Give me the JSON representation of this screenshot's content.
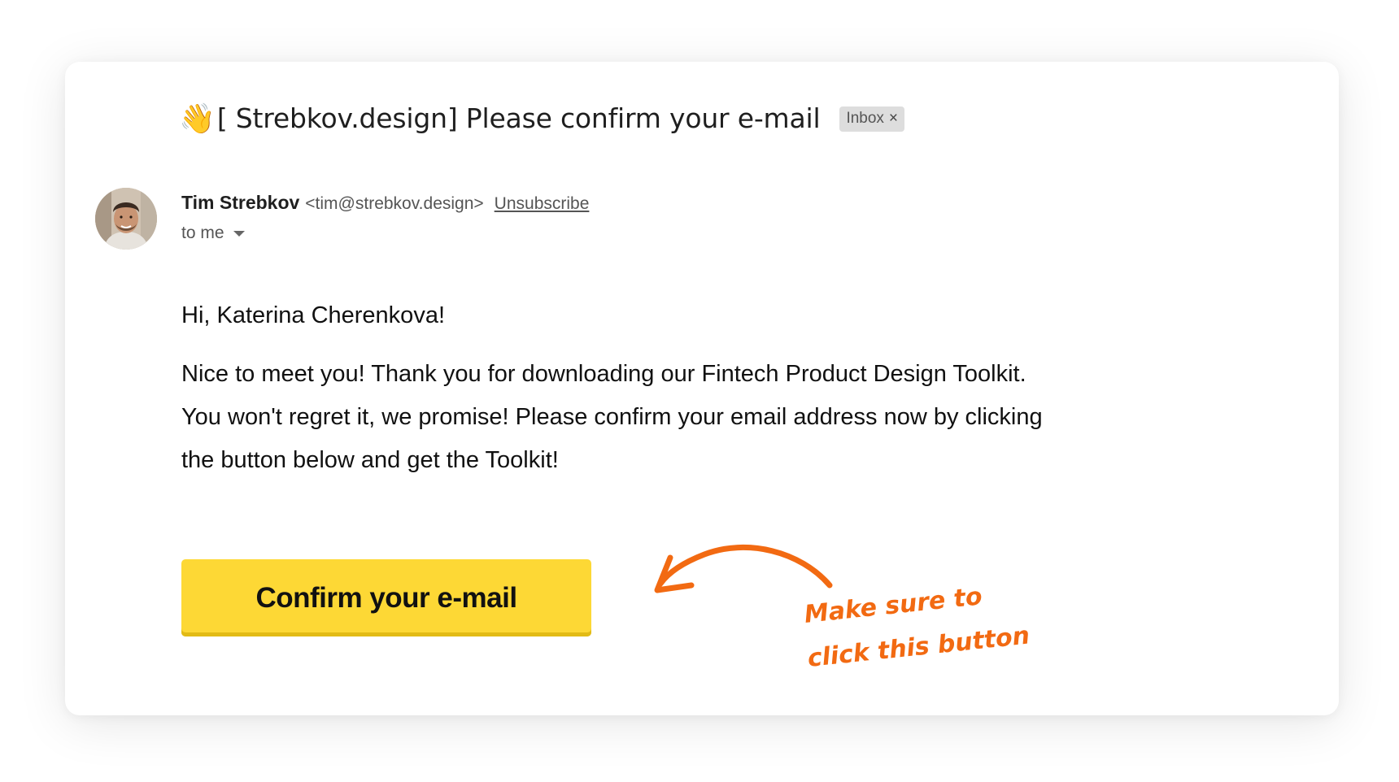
{
  "email": {
    "subject_emoji": "👋",
    "subject": "[ Strebkov.design] Please confirm your e-mail",
    "label_chip": "Inbox",
    "label_close": "×",
    "sender_name": "Tim Strebkov",
    "sender_email": "<tim@strebkov.design>",
    "unsubscribe": "Unsubscribe",
    "recipient": "to me",
    "greeting": "Hi, Katerina Cherenkova!",
    "body_lines": [
      "Nice to meet you! Thank you for downloading our Fintech Product Design Toolkit.",
      "You won't regret it, we promise! Please confirm your email address now by clicking",
      "the button below and get the Toolkit!"
    ],
    "cta_label": "Confirm your e-mail"
  },
  "annotation": {
    "line1": "Make sure to",
    "line2": "click this button"
  },
  "colors": {
    "cta_background": "#fdd835",
    "annotation": "#f26a12",
    "chip_background": "#dddddd"
  },
  "icons": {
    "subject_emoji": "waving-hand-icon",
    "avatar": "sender-avatar",
    "recipient_toggle": "caret-down-icon",
    "annotation_arrow": "curved-arrow-icon",
    "chip_remove": "close-icon"
  }
}
